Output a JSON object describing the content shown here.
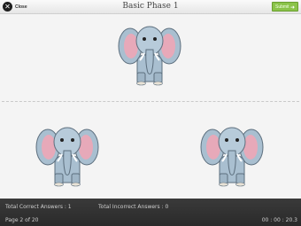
{
  "header": {
    "close_label": "Close",
    "close_glyph": "✕",
    "title": "Basic Phase 1",
    "submit_label": "Submit",
    "submit_glyph": "➜"
  },
  "board": {
    "items": [
      {
        "name": "elephant",
        "icon": "elephant-picture"
      },
      {
        "name": "elephant",
        "icon": "elephant-picture"
      },
      {
        "name": "elephant",
        "icon": "elephant-picture"
      }
    ]
  },
  "footer": {
    "correct": "Total Correct Answers : 1",
    "incorrect": "Total Incorrect Answers : 0",
    "page": "Page 2 of 20",
    "timer": "00 : 00 : 20.3"
  },
  "colors": {
    "submit": "#8bc34a",
    "footer": "#303030",
    "elephant_body": "#a9bfd0",
    "elephant_ear_inner": "#e7a9b9"
  }
}
